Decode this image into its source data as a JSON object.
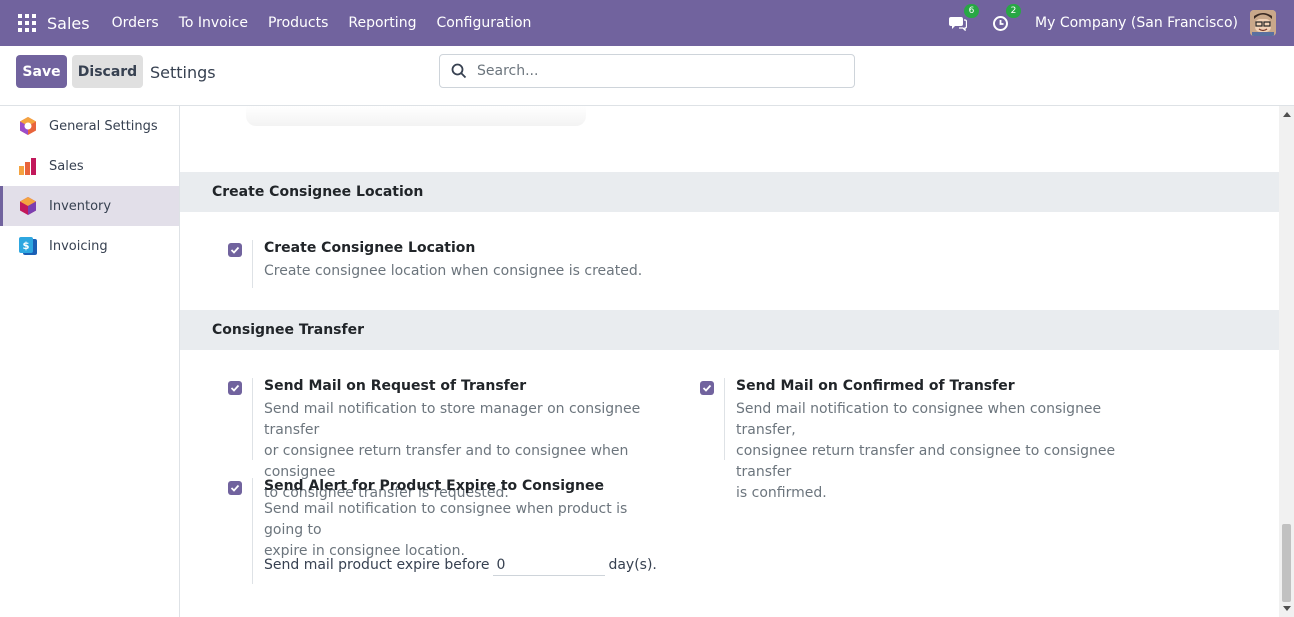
{
  "navbar": {
    "app_name": "Sales",
    "menu": [
      "Orders",
      "To Invoice",
      "Products",
      "Reporting",
      "Configuration"
    ],
    "messages_count": "6",
    "activities_count": "2",
    "company": "My Company (San Francisco)",
    "accent_color": "#71639e"
  },
  "control_panel": {
    "save_label": "Save",
    "discard_label": "Discard",
    "title": "Settings",
    "search_placeholder": "Search..."
  },
  "sidebar": {
    "items": [
      {
        "label": "General Settings",
        "icon": "general-settings-icon",
        "active": false
      },
      {
        "label": "Sales",
        "icon": "sales-icon",
        "active": false
      },
      {
        "label": "Inventory",
        "icon": "inventory-icon",
        "active": true
      },
      {
        "label": "Invoicing",
        "icon": "invoicing-icon",
        "active": false
      }
    ]
  },
  "sections": {
    "create_location": {
      "header": "Create Consignee Location",
      "setting": {
        "title": "Create Consignee Location",
        "description": "Create consignee location when consignee is created.",
        "checked": true
      }
    },
    "transfer": {
      "header": "Consignee Transfer",
      "request_mail": {
        "title": "Send Mail on Request of Transfer",
        "description_lines": [
          "Send mail notification to store manager on consignee transfer",
          "or consignee return transfer and to consignee when consignee",
          "to consignee transfer is requested."
        ],
        "checked": true
      },
      "confirmed_mail": {
        "title": "Send Mail on Confirmed of Transfer",
        "description_lines": [
          "Send mail notification to consignee when consignee transfer,",
          "consignee return transfer and consignee to consignee transfer",
          "is confirmed."
        ],
        "checked": true
      },
      "expire_alert": {
        "title": "Send Alert for Product Expire to Consignee",
        "description_lines": [
          "Send mail notification to consignee when product is going to",
          "expire in consignee location."
        ],
        "checked": true,
        "before_label": "Send mail product expire before",
        "days_value": "0",
        "days_suffix": "day(s)."
      }
    }
  }
}
